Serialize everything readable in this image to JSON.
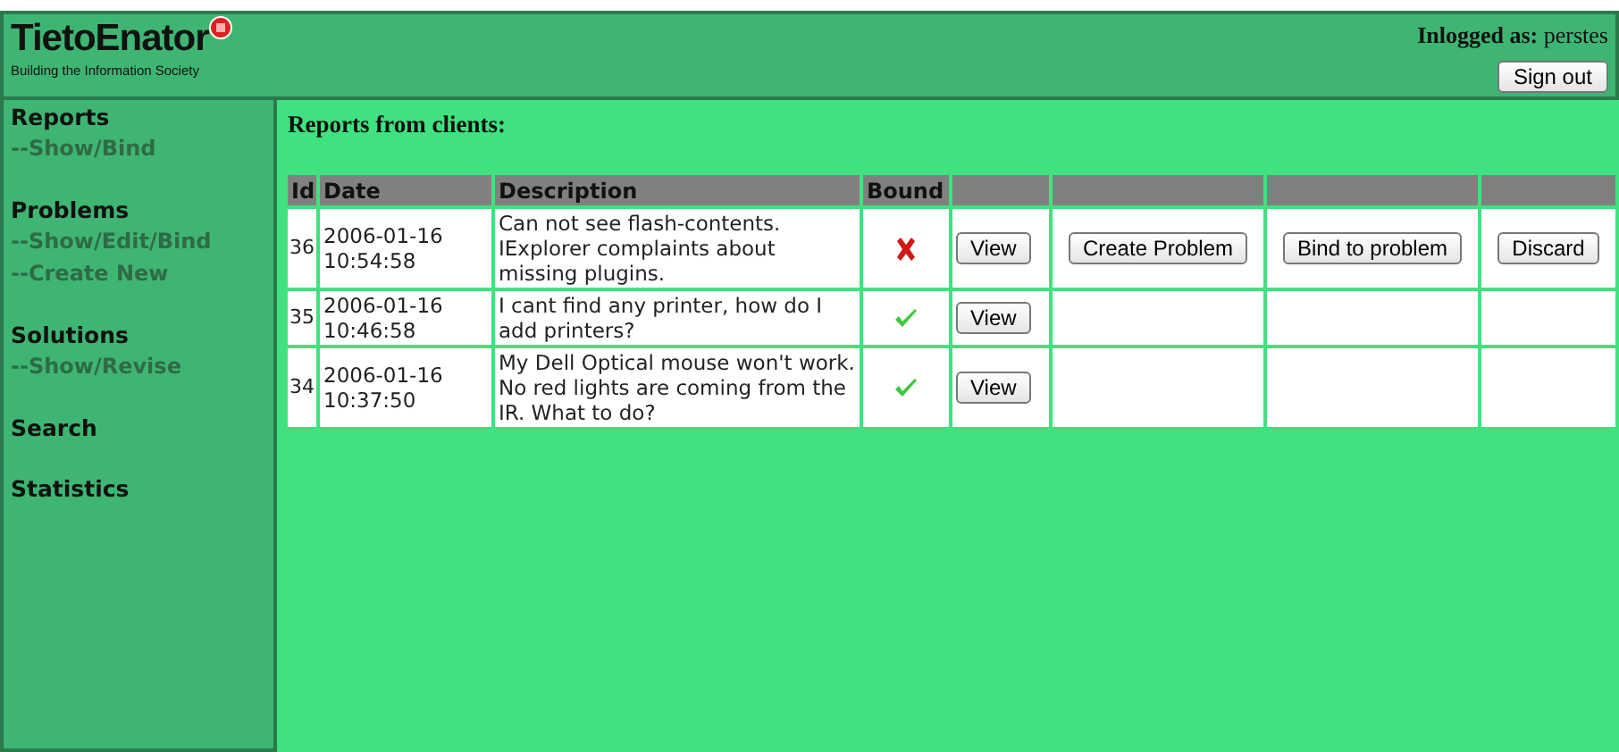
{
  "header": {
    "logo": "TietoEnator",
    "tagline": "Building the Information Society",
    "user_label": "Inlogged as:",
    "user": "perstes",
    "sign_out": "Sign out"
  },
  "sidebar": [
    {
      "heading": "Reports",
      "links": [
        "--Show/Bind"
      ]
    },
    {
      "heading": "Problems",
      "links": [
        "--Show/Edit/Bind",
        "--Create New"
      ]
    },
    {
      "heading": "Solutions",
      "links": [
        "--Show/Revise"
      ]
    },
    {
      "heading": "Search"
    },
    {
      "heading": "Statistics"
    }
  ],
  "content": {
    "title": "Reports from clients:",
    "table": {
      "columns": [
        "Id",
        "Date",
        "Description",
        "Bound"
      ],
      "rows": [
        {
          "id": "36",
          "date": "2006-01-16 10:54:58",
          "description": "Can not see flash-contents. IExplorer complaints about missing plugins.",
          "bound": false,
          "actions": [
            "View",
            "Create Problem",
            "Bind to problem",
            "Discard"
          ]
        },
        {
          "id": "35",
          "date": "2006-01-16 10:46:58",
          "description": "I cant find any printer, how do I add printers?",
          "bound": true,
          "actions": [
            "View"
          ]
        },
        {
          "id": "34",
          "date": "2006-01-16 10:37:50",
          "description": "My Dell Optical mouse won't work. No red lights are coming from the IR. What to do?",
          "bound": true,
          "actions": [
            "View"
          ]
        }
      ]
    }
  }
}
